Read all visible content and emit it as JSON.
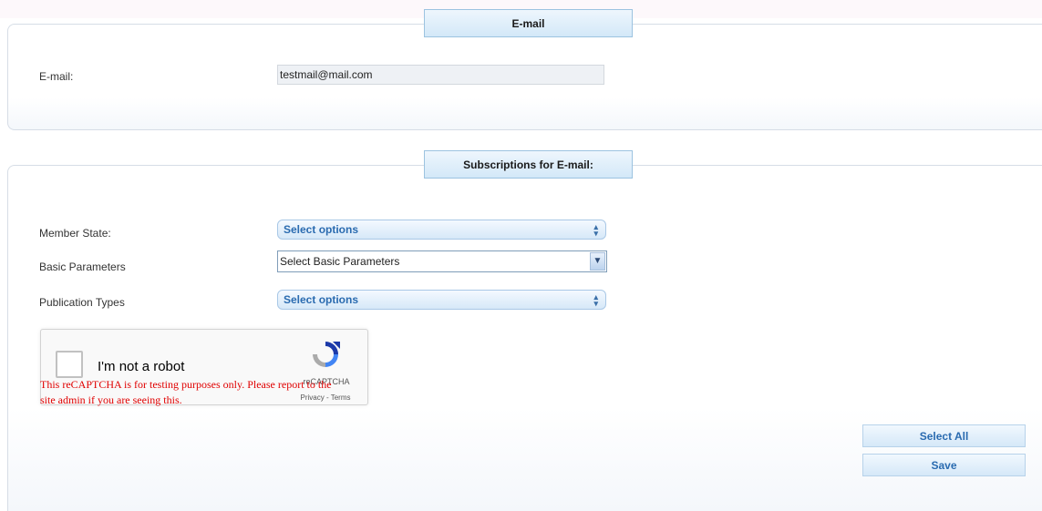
{
  "email_section": {
    "title": "E-mail",
    "label": "E-mail:",
    "value": "testmail@mail.com"
  },
  "subscriptions_section": {
    "title": "Subscriptions for E-mail:",
    "member_state": {
      "label": "Member State:",
      "value": "Select options"
    },
    "basic_parameters": {
      "label": "Basic Parameters",
      "value": "Select Basic Parameters"
    },
    "publication_types": {
      "label": "Publication Types",
      "value": "Select options"
    }
  },
  "recaptcha": {
    "checkbox_label": "I'm not a robot",
    "brand": "reCAPTCHA",
    "links": "Privacy - Terms",
    "warning": "This reCAPTCHA is for testing purposes only. Please report to the site admin if you are seeing this."
  },
  "buttons": {
    "select_all": "Select All",
    "save": "Save"
  },
  "icons": {
    "multiselect_arrows": "up-down-arrows-icon",
    "dropdown_arrow": "chevron-down-icon",
    "recaptcha_logo": "recaptcha-logo-icon"
  },
  "colors": {
    "accent_text": "#2a6bb0",
    "header_bg": "#d3e8f8",
    "warning_text": "#e00000"
  }
}
